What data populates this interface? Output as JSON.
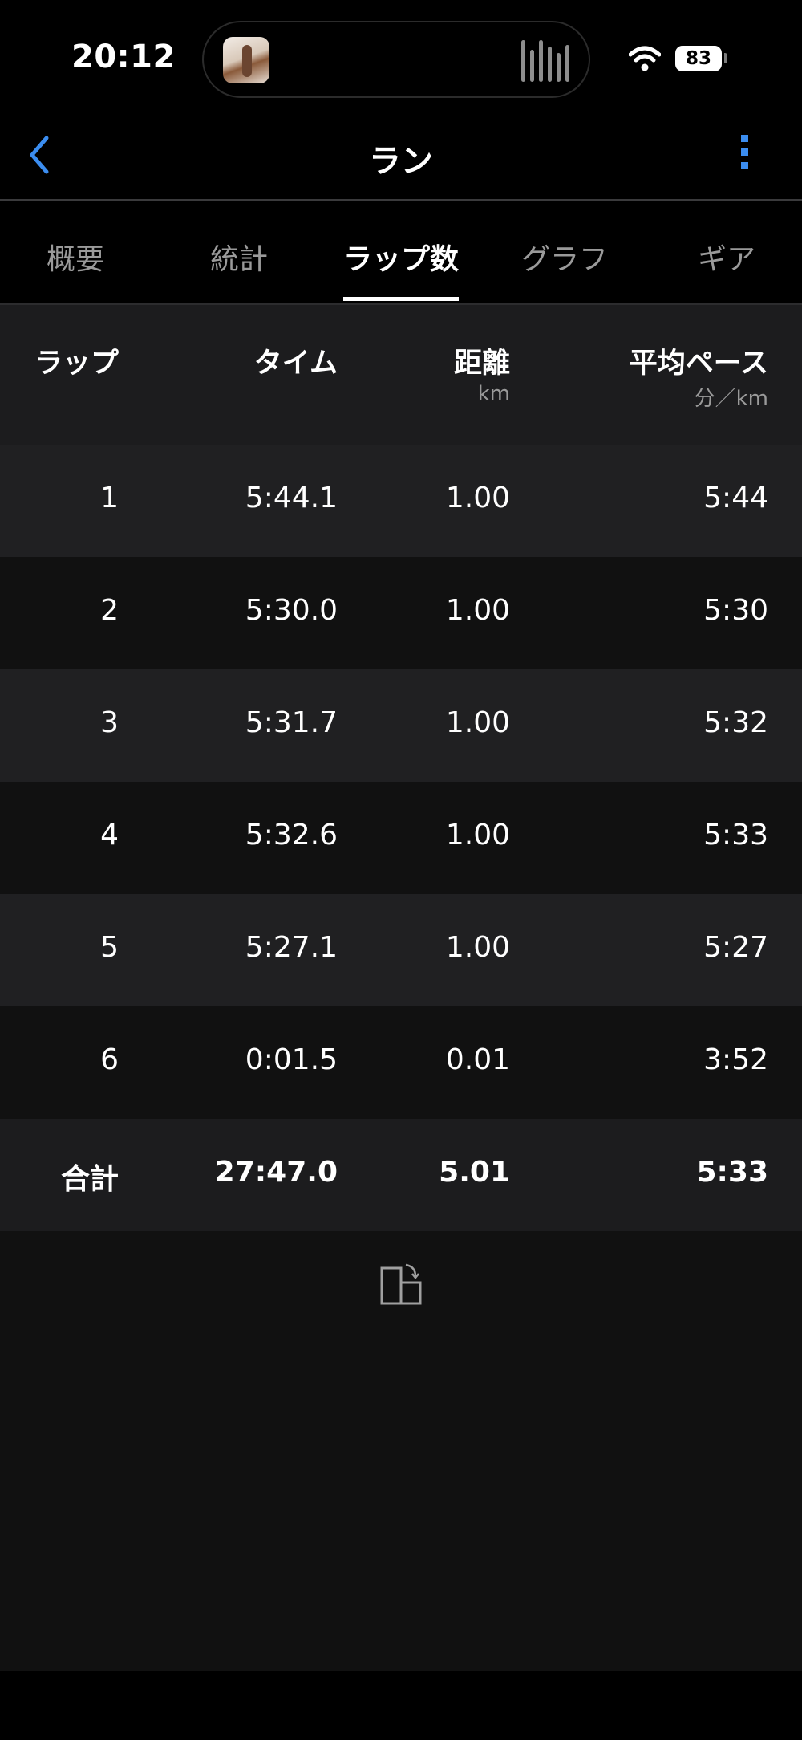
{
  "status_bar": {
    "time": "20:12",
    "battery": "83"
  },
  "nav": {
    "title": "ラン",
    "back_icon": "chevron-left-icon",
    "more_icon": "more-vertical-icon",
    "accent": "#3b8df0"
  },
  "tabs": [
    {
      "label": "概要"
    },
    {
      "label": "統計"
    },
    {
      "label": "ラップ数",
      "active": true
    },
    {
      "label": "グラフ"
    },
    {
      "label": "ギア"
    }
  ],
  "table": {
    "headers": {
      "lap": "ラップ",
      "time": "タイム",
      "distance": "距離",
      "distance_unit": "km",
      "pace": "平均ペース",
      "pace_unit": "分／km"
    },
    "rows": [
      {
        "lap": "1",
        "time": "5:44.1",
        "distance": "1.00",
        "pace": "5:44"
      },
      {
        "lap": "2",
        "time": "5:30.0",
        "distance": "1.00",
        "pace": "5:30"
      },
      {
        "lap": "3",
        "time": "5:31.7",
        "distance": "1.00",
        "pace": "5:32"
      },
      {
        "lap": "4",
        "time": "5:32.6",
        "distance": "1.00",
        "pace": "5:33"
      },
      {
        "lap": "5",
        "time": "5:27.1",
        "distance": "1.00",
        "pace": "5:27"
      },
      {
        "lap": "6",
        "time": "0:01.5",
        "distance": "0.01",
        "pace": "3:52"
      }
    ],
    "total": {
      "lap": "合計",
      "time": "27:47.0",
      "distance": "5.01",
      "pace": "5:33"
    }
  },
  "footer": {
    "rotate_icon": "rotate-screen-icon"
  }
}
